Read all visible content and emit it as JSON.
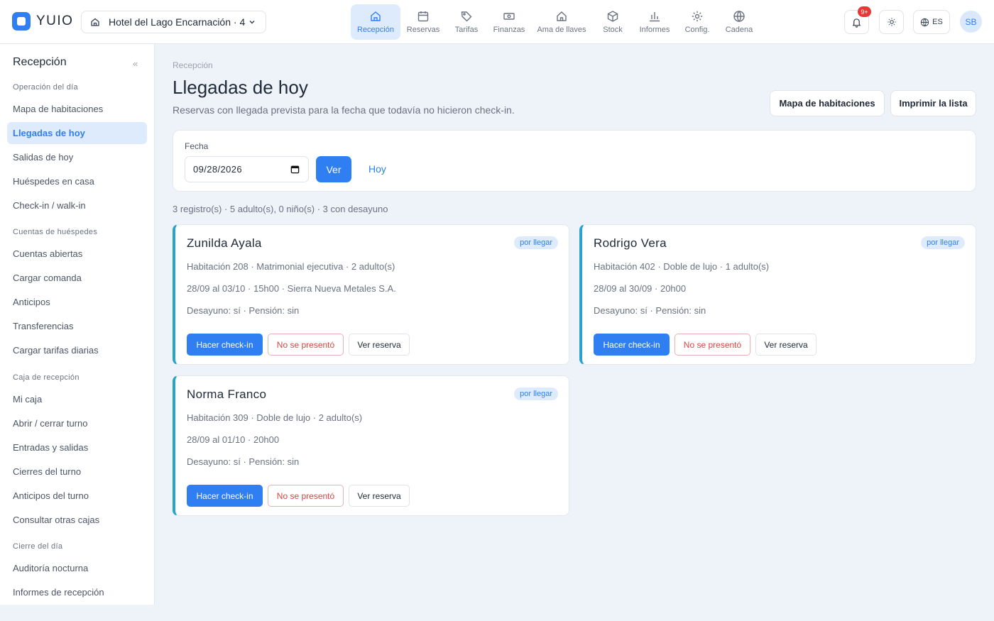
{
  "app": {
    "logo_text": "YUIO",
    "hotel": "Hotel del Lago Encarnación · 4"
  },
  "nav": [
    {
      "label": "Recepción",
      "icon": "home-icon",
      "active": true
    },
    {
      "label": "Reservas",
      "icon": "calendar-icon"
    },
    {
      "label": "Tarifas",
      "icon": "tag-icon"
    },
    {
      "label": "Finanzas",
      "icon": "banknote-icon"
    },
    {
      "label": "Ama de llaves",
      "icon": "house-icon"
    },
    {
      "label": "Stock",
      "icon": "box-icon"
    },
    {
      "label": "Informes",
      "icon": "bar-chart-icon"
    },
    {
      "label": "Config.",
      "icon": "gear-icon"
    },
    {
      "label": "Cadena",
      "icon": "globe-icon"
    }
  ],
  "topbar": {
    "notif_badge": "9+",
    "lang": "ES",
    "avatar": "SB"
  },
  "sidebar": {
    "title": "Recepción",
    "collapse": "«",
    "sections": [
      {
        "title": "Operación del día",
        "items": [
          "Mapa de habitaciones",
          "Llegadas de hoy",
          "Salidas de hoy",
          "Huéspedes en casa",
          "Check-in / walk-in"
        ]
      },
      {
        "title": "Cuentas de huéspedes",
        "items": [
          "Cuentas abiertas",
          "Cargar comanda",
          "Anticipos",
          "Transferencias",
          "Cargar tarifas diarias"
        ]
      },
      {
        "title": "Caja de recepción",
        "items": [
          "Mi caja",
          "Abrir / cerrar turno",
          "Entradas y salidas",
          "Cierres del turno",
          "Anticipos del turno",
          "Consultar otras cajas"
        ]
      },
      {
        "title": "Cierre del día",
        "items": [
          "Auditoría nocturna",
          "Informes de recepción"
        ]
      }
    ],
    "active_item": "Llegadas de hoy"
  },
  "page": {
    "breadcrumb": "Recepción",
    "title": "Llegadas de hoy",
    "subtitle": "Reservas con llegada prevista para la fecha que todavía no hicieron check-in.",
    "btn_map": "Mapa de habitaciones",
    "btn_print": "Imprimir la lista"
  },
  "filter": {
    "label": "Fecha",
    "date": "09/28/2026",
    "btn_ver": "Ver",
    "btn_hoy": "Hoy"
  },
  "summary": "3 registro(s) · 5 adulto(s), 0 niño(s) · 3 con desayuno",
  "cards": [
    {
      "name": "Zunilda Ayala",
      "badge": "por llegar",
      "line1": "Habitación 208 · Matrimonial ejecutiva · 2 adulto(s)",
      "line2": "28/09 al 03/10 · 15h00 · Sierra Nueva Metales S.A.",
      "line3": "Desayuno: sí · Pensión: sin"
    },
    {
      "name": "Rodrigo Vera",
      "badge": "por llegar",
      "line1": "Habitación 402 · Doble de lujo · 1 adulto(s)",
      "line2": "28/09 al 30/09 · 20h00",
      "line3": "Desayuno: sí · Pensión: sin"
    },
    {
      "name": "Norma Franco",
      "badge": "por llegar",
      "line1": "Habitación 309 · Doble de lujo · 2 adulto(s)",
      "line2": "28/09 al 01/10 · 20h00",
      "line3": "Desayuno: sí · Pensión: sin"
    }
  ],
  "card_actions": {
    "checkin": "Hacer check-in",
    "noshow": "No se presentó",
    "view": "Ver reserva"
  },
  "colors": {
    "accent": "#2f7ff2",
    "card_border": "#29a3cc",
    "danger": "#d64541",
    "badge_bg": "#deebfd"
  }
}
